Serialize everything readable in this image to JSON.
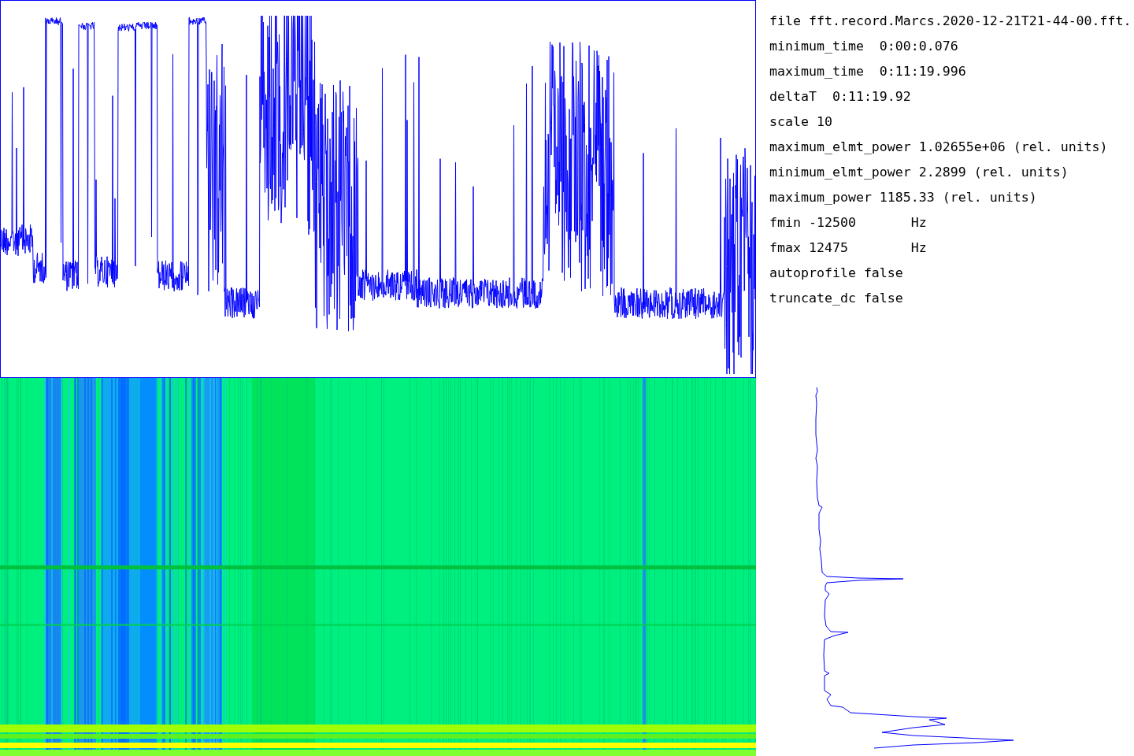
{
  "info_lines": [
    "file fft.record.Marcs.2020-12-21T21-44-00.fft.",
    "minimum_time  0:00:0.076",
    "maximum_time  0:11:19.996",
    "deltaT  0:11:19.92",
    "scale 10",
    "maximum_elmt_power 1.02655e+06 (rel. units)",
    "minimum_elmt_power 2.2899 (rel. units)",
    "maximum_power 1185.33 (rel. units)",
    "fmin -12500       Hz",
    "fmax 12475        Hz",
    "autoprofile false",
    "truncate_dc false"
  ]
}
